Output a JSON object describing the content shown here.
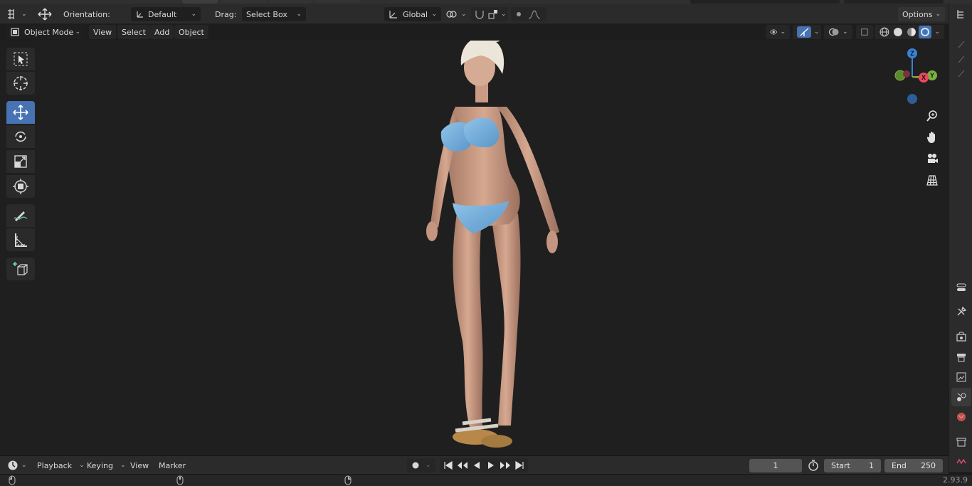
{
  "colors": {
    "accent": "#4772b3",
    "axis_x": "#e94a5a",
    "axis_y": "#7ab23f",
    "axis_z": "#3b82d6",
    "viewport_bg": "#1f1f1f"
  },
  "tool_header": {
    "orientation_label": "Orientation:",
    "orientation_value": "Default",
    "drag_label": "Drag:",
    "drag_value": "Select Box",
    "transform_space": "Global",
    "options_label": "Options"
  },
  "viewport_header": {
    "mode": "Object Mode",
    "menus": [
      "View",
      "Select",
      "Add",
      "Object"
    ]
  },
  "toolbar": {
    "tools": [
      {
        "name": "select-box-icon",
        "active": false
      },
      {
        "name": "cursor-icon",
        "active": false
      },
      {
        "name": "move-icon",
        "active": true
      },
      {
        "name": "rotate-icon",
        "active": false
      },
      {
        "name": "scale-icon",
        "active": false
      },
      {
        "name": "transform-icon",
        "active": false
      },
      {
        "name": "annotate-icon",
        "active": false
      },
      {
        "name": "measure-icon",
        "active": false
      },
      {
        "name": "add-cube-icon",
        "active": false
      }
    ]
  },
  "gizmo": {
    "x_label": "X",
    "y_label": "Y",
    "z_label": "Z"
  },
  "timeline": {
    "playback_label": "Playback",
    "keying_label": "Keying",
    "view_label": "View",
    "marker_label": "Marker",
    "current_frame": "1",
    "start_label": "Start",
    "start_value": "1",
    "end_label": "End",
    "end_value": "250"
  },
  "status": {
    "version": "2.93.9"
  }
}
